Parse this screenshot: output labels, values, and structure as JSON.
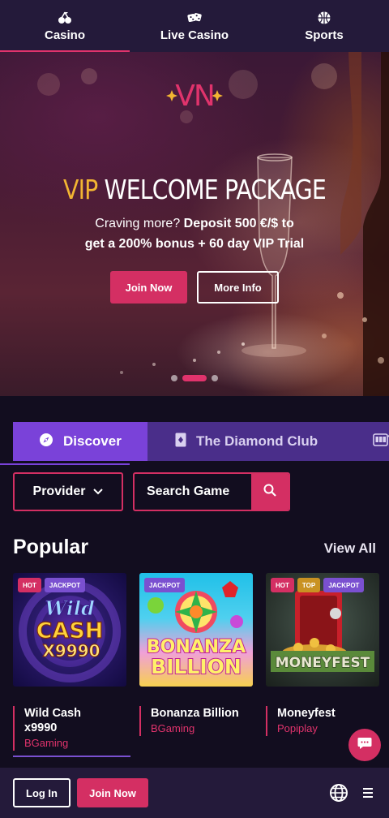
{
  "top_nav": {
    "tabs": [
      {
        "label": "Casino",
        "icon": "cherries-icon",
        "active": true
      },
      {
        "label": "Live Casino",
        "icon": "dice-icon",
        "active": false
      },
      {
        "label": "Sports",
        "icon": "basketball-icon",
        "active": false
      }
    ]
  },
  "hero": {
    "logo_text": "VN",
    "headline_highlight": "VIP",
    "headline_rest": "WELCOME PACKAGE",
    "sub_line1_plain": "Craving more?",
    "sub_line1_bold": "Deposit 500 €/$ to",
    "sub_line2_bold": "get a 200% bonus + 60 day VIP Trial",
    "join_label": "Join Now",
    "more_label": "More Info",
    "slide_count": 3,
    "active_slide": 2
  },
  "categories": [
    {
      "label": "Discover",
      "icon": "compass-icon",
      "active": true
    },
    {
      "label": "The Diamond Club",
      "icon": "diamond-card-icon",
      "active": false
    },
    {
      "label": "",
      "icon": "slot-machine-icon",
      "active": false
    }
  ],
  "filters": {
    "provider_label": "Provider",
    "search_placeholder": "Search Game"
  },
  "popular": {
    "title": "Popular",
    "view_all": "View All",
    "games": [
      {
        "name_line1": "Wild Cash",
        "name_line2": "x9990",
        "provider": "BGaming",
        "badges": [
          "HOT",
          "JACKPOT"
        ],
        "art_line1": "Wild",
        "art_line2": "CASH",
        "art_line3": "X9990"
      },
      {
        "name_line1": "Bonanza Billion",
        "name_line2": "",
        "provider": "BGaming",
        "badges": [
          "JACKPOT"
        ],
        "art_line1": "BONANZA",
        "art_line2": "BILLION"
      },
      {
        "name_line1": "Moneyfest",
        "name_line2": "",
        "provider": "Popiplay",
        "badges": [
          "HOT",
          "TOP",
          "JACKPOT"
        ],
        "art_line1": "MONEYFEST"
      }
    ]
  },
  "bottom_bar": {
    "login_label": "Log In",
    "join_label": "Join Now"
  },
  "colors": {
    "accent": "#d42f63",
    "purple": "#7a42d9",
    "gold": "#f2b532",
    "bg": "#120d1f",
    "bar": "#241a3a"
  }
}
